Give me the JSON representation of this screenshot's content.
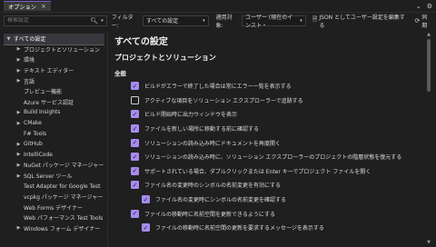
{
  "title_tab": "オプション",
  "search": {
    "placeholder": "検索設定",
    "value": ""
  },
  "filter_label": "フィルター:",
  "filter_value": "すべての設定",
  "apply_label": "適用対象:",
  "apply_value": "ユーザー (現在のインスト・",
  "edit_json_label": "JSON としてユーザー設定を編集する",
  "sync_label": "同期",
  "sidebar": [
    {
      "label": "すべての設定",
      "arrow": "▼",
      "level": 0,
      "selected": true
    },
    {
      "label": "プロジェクトとソリューション",
      "arrow": "▶",
      "level": 1
    },
    {
      "label": "環境",
      "arrow": "▶",
      "level": 1
    },
    {
      "label": "テキスト エディター",
      "arrow": "▶",
      "level": 1
    },
    {
      "label": "言語",
      "arrow": "▶",
      "level": 1
    },
    {
      "label": "プレビュー機能",
      "arrow": "",
      "level": 1
    },
    {
      "label": "Azure サービス認証",
      "arrow": "",
      "level": 1
    },
    {
      "label": "Build Insights",
      "arrow": "▶",
      "level": 1
    },
    {
      "label": "CMake",
      "arrow": "▶",
      "level": 1
    },
    {
      "label": "F# Tools",
      "arrow": "",
      "level": 1
    },
    {
      "label": "GitHub",
      "arrow": "▶",
      "level": 1
    },
    {
      "label": "IntelliCode",
      "arrow": "▶",
      "level": 1
    },
    {
      "label": "NuGet パッケージ マネージャー",
      "arrow": "▶",
      "level": 1
    },
    {
      "label": "SQL Server ツール",
      "arrow": "▶",
      "level": 1
    },
    {
      "label": "Test Adapter for Google Test",
      "arrow": "",
      "level": 1
    },
    {
      "label": "vcpkg パッケージ マネージャー",
      "arrow": "",
      "level": 1
    },
    {
      "label": "Web Forms デザイナー",
      "arrow": "",
      "level": 1
    },
    {
      "label": "Web パフォーマンス Test Tools",
      "arrow": "",
      "level": 1
    },
    {
      "label": "Windows フォーム デザイナー",
      "arrow": "▶",
      "level": 1
    }
  ],
  "content": {
    "title": "すべての設定",
    "section": "プロジェクトとソリューション",
    "group": "全般",
    "options": [
      {
        "label": "ビルドがエラーで終了した場合は常にエラー一覧を表示する",
        "checked": true,
        "indent": false
      },
      {
        "label": "アクティブな項目をソリューション エクスプローラーで追跡する",
        "checked": false,
        "indent": false
      },
      {
        "label": "ビルド開始時に出力ウィンドウを表示",
        "checked": true,
        "indent": false
      },
      {
        "label": "ファイルを新しい場所に移動する前に確認する",
        "checked": true,
        "indent": false
      },
      {
        "label": "ソリューションの読み込み時にドキュメントを再度開く",
        "checked": true,
        "indent": false
      },
      {
        "label": "ソリューションの読み込み時に、ソリューション エクスプローラーのプロジェクトの階層状態を復元する",
        "checked": true,
        "indent": false
      },
      {
        "label": "サポートされている場合、ダブルクリックまたは Enter キーでプロジェクト ファイルを開く",
        "checked": true,
        "indent": false
      },
      {
        "label": "ファイル名の変更時のシンボルの名前変更を有効にする",
        "checked": true,
        "indent": false
      },
      {
        "label": "ファイル名の変更時にシンボルの名前変更を確認する",
        "checked": true,
        "indent": true
      },
      {
        "label": "ファイルの移動時に名前空間を更新できるようにする",
        "checked": true,
        "indent": false
      },
      {
        "label": "ファイルの移動時に名前空間の更新を要求するメッセージを表示する",
        "checked": true,
        "indent": true
      }
    ]
  },
  "colors": {
    "accent": "#a78bf0",
    "background": "#1f1f1f",
    "selected": "#37373d"
  }
}
